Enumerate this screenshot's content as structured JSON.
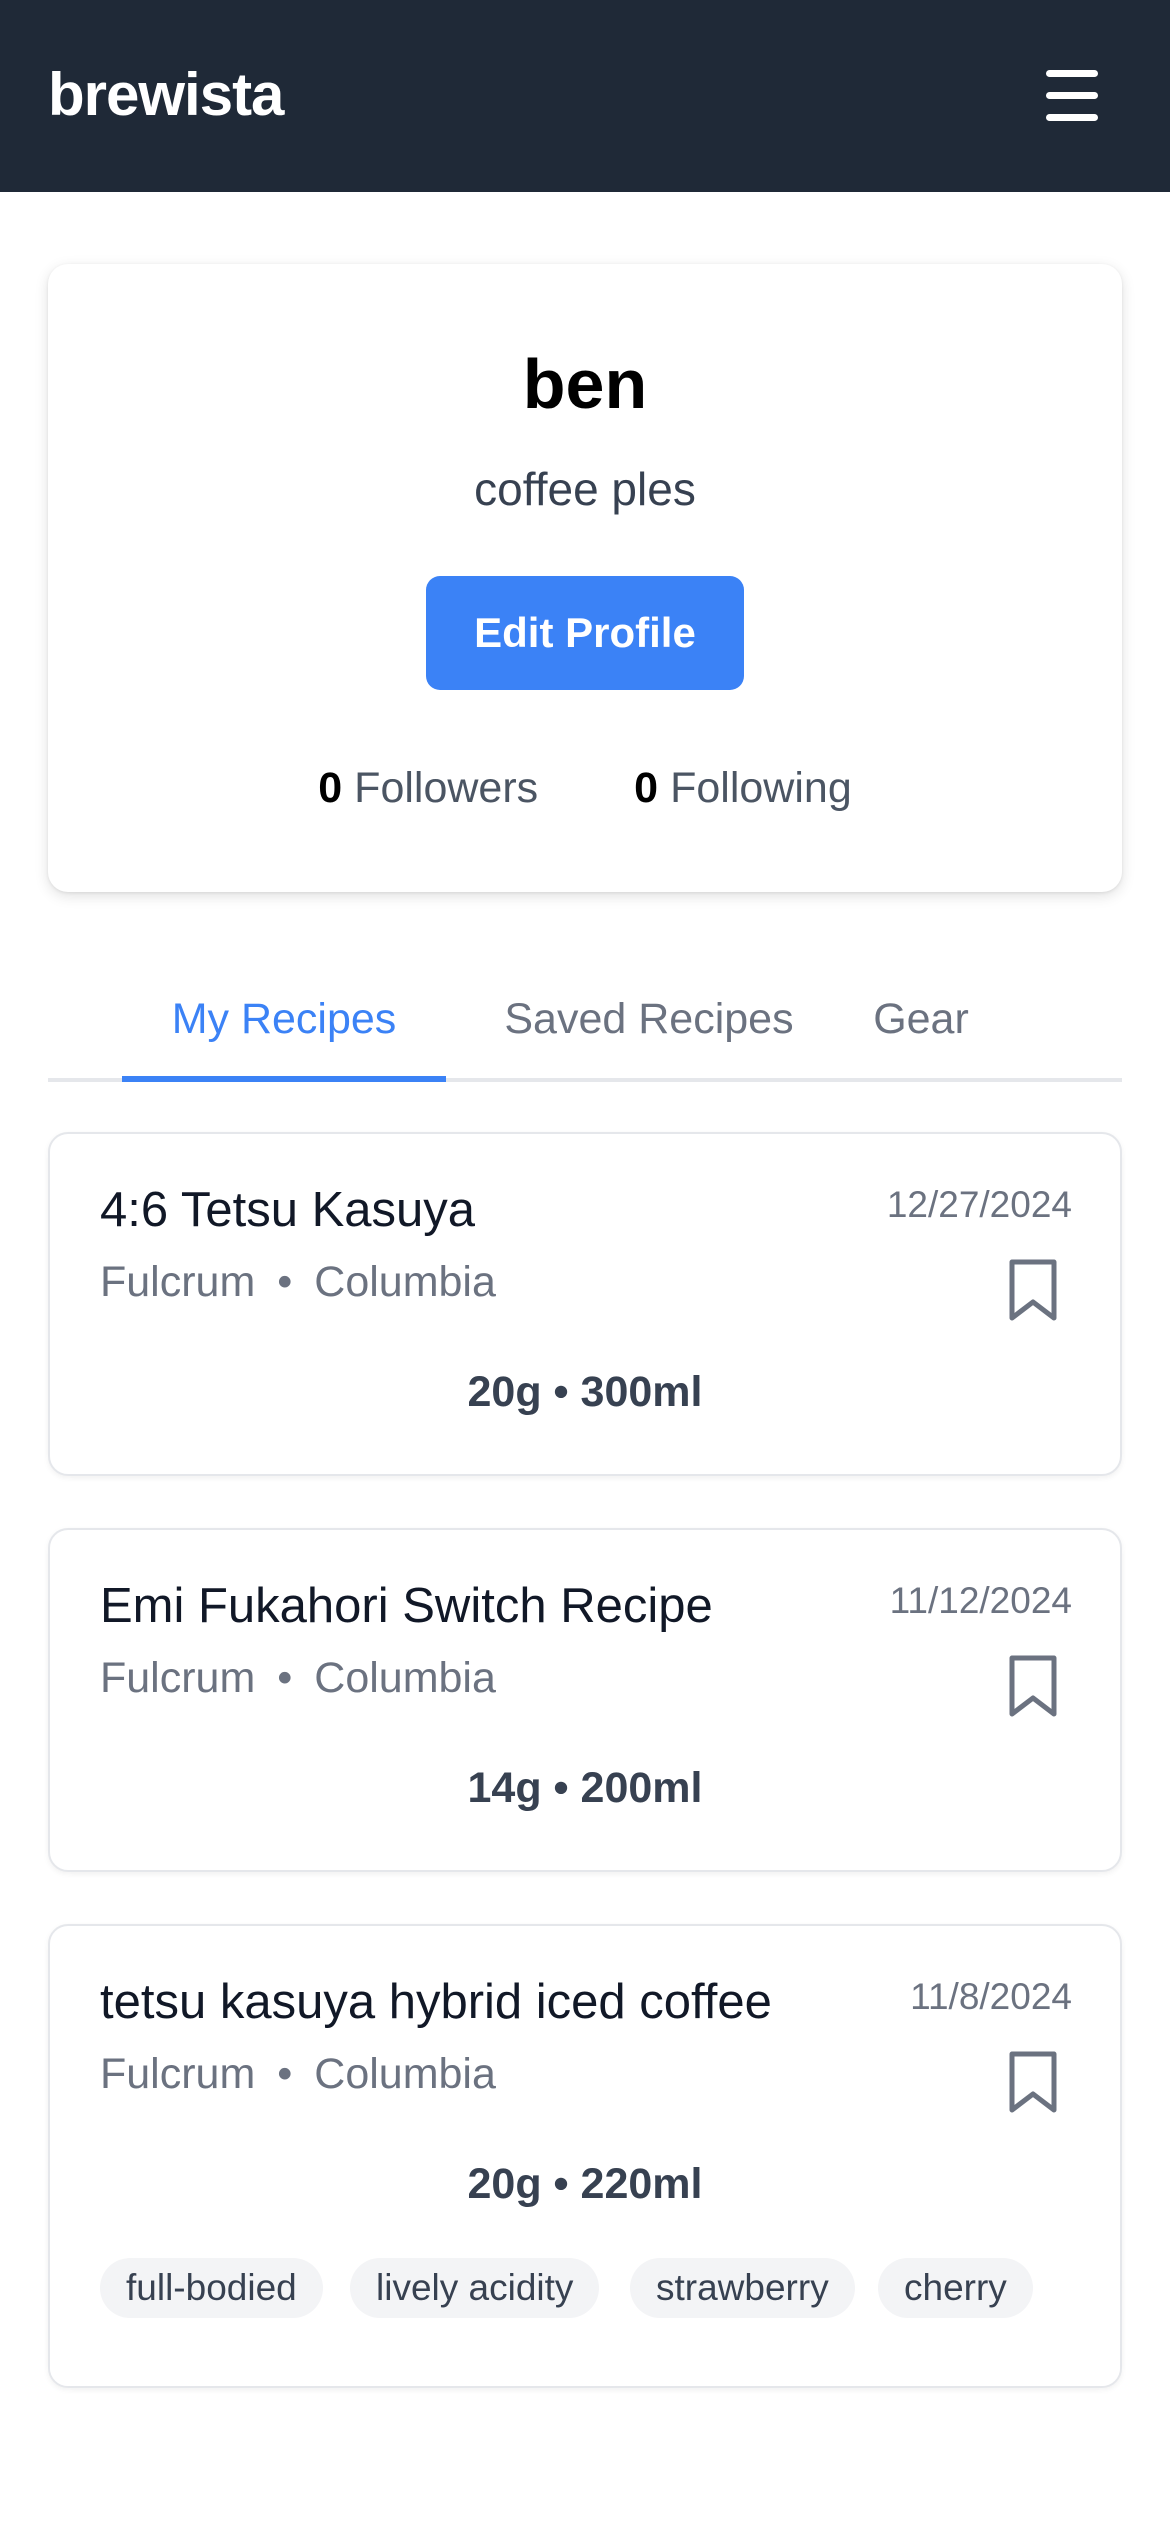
{
  "header": {
    "brand": "brewista",
    "menu_icon": "hamburger-menu-icon"
  },
  "profile": {
    "username": "ben",
    "bio": "coffee ples",
    "edit_label": "Edit Profile",
    "followers_count": "0",
    "followers_label": "Followers",
    "following_count": "0",
    "following_label": "Following"
  },
  "tabs": [
    {
      "label": "My Recipes",
      "active": true
    },
    {
      "label": "Saved Recipes",
      "active": false
    },
    {
      "label": "Gear",
      "active": false
    }
  ],
  "recipes": [
    {
      "title": "4:6 Tetsu Kasuya",
      "roaster": "Fulcrum",
      "origin": "Columbia",
      "separator": "•",
      "date": "12/27/2024",
      "dose": "20g",
      "water": "300ml",
      "meta": "20g • 300ml",
      "icon": "bookmark-icon"
    },
    {
      "title": "Emi Fukahori Switch Recipe",
      "roaster": "Fulcrum",
      "origin": "Columbia",
      "separator": "•",
      "date": "11/12/2024",
      "dose": "14g",
      "water": "200ml",
      "meta": "14g • 200ml",
      "icon": "bookmark-icon"
    },
    {
      "title": "tetsu kasuya hybrid iced coffee",
      "roaster": "Fulcrum",
      "origin": "Columbia",
      "separator": "•",
      "date": "11/8/2024",
      "dose": "20g",
      "water": "220ml",
      "meta": "20g • 220ml",
      "icon": "bookmark-icon",
      "tags": [
        "full-bodied",
        "lively acidity",
        "strawberry",
        "cherry"
      ]
    }
  ],
  "colors": {
    "navbar": "#1f2937",
    "accent": "#3b82f6",
    "muted": "#6b7280"
  }
}
